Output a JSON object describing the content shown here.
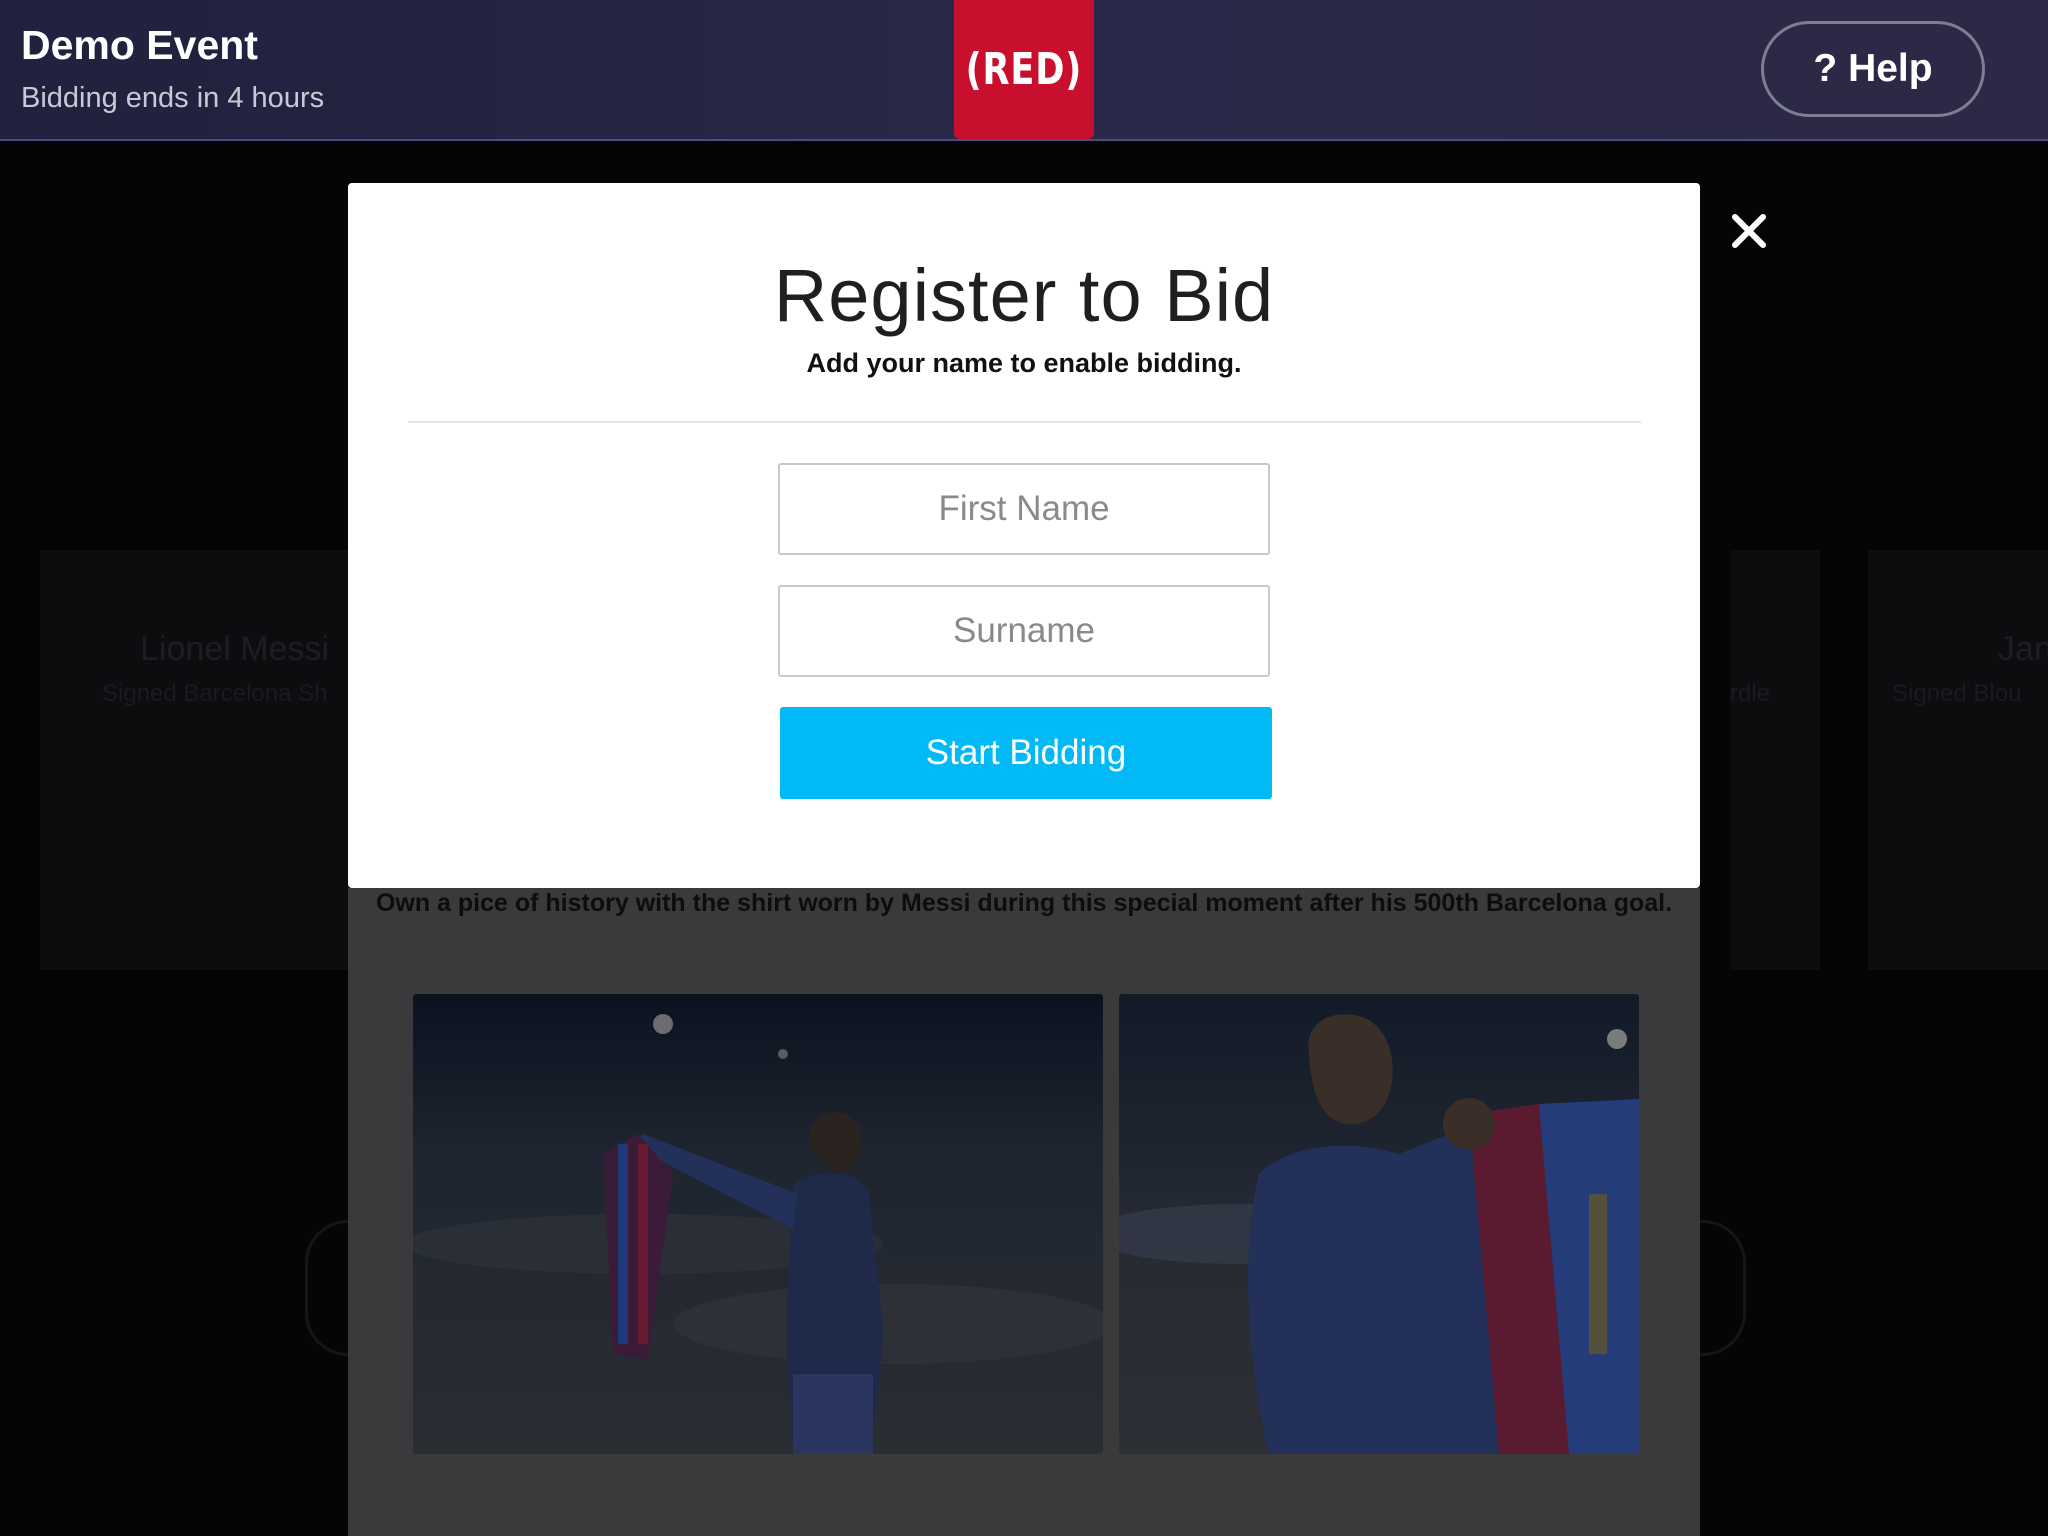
{
  "header": {
    "event_title": "Demo Event",
    "event_subtitle": "Bidding ends in 4 hours",
    "logo_text": "(RED)",
    "help_label": "? Help"
  },
  "modal": {
    "title": "Register to Bid",
    "subtitle": "Add your name to enable bidding.",
    "first_name_placeholder": "First Name",
    "surname_placeholder": "Surname",
    "start_button_label": "Start Bidding",
    "close_icon": "close-icon"
  },
  "background": {
    "left_card_name": "Lionel Messi",
    "left_card_sub": "Signed Barcelona Sh",
    "right_card_sub": "rdle",
    "far_card_name": "Jan",
    "far_card_sub": "Signed Blou",
    "description": "Own a pice of history with the shirt worn by Messi during this special moment after his 500th Barcelona goal."
  },
  "colors": {
    "accent": "#00b9f5",
    "brand_red": "#c8102e",
    "header_bg": "#242444"
  }
}
